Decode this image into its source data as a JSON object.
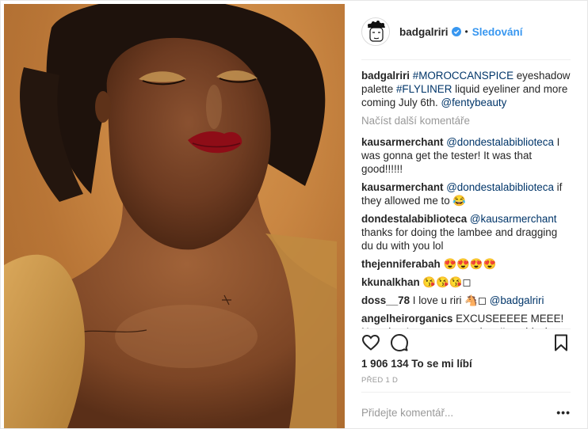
{
  "post": {
    "username": "badgalriri",
    "follow_label": "Sledování",
    "separator": "•",
    "caption_user": "badgalriri",
    "caption_parts": [
      {
        "type": "tag",
        "text": "#MOROCCANSPICE"
      },
      {
        "type": "text",
        "text": " eyeshadow palette "
      },
      {
        "type": "tag",
        "text": "#FLYLINER"
      },
      {
        "type": "text",
        "text": " liquid eyeliner and more coming July 6th. "
      },
      {
        "type": "tag",
        "text": "@fentybeauty"
      }
    ],
    "load_more_label": "Načíst další komentáře",
    "comments": [
      {
        "user": "kausarmerchant",
        "mention": "@dondestalabiblioteca",
        "text": " I was gonna get the tester! It was that good!!!!!!"
      },
      {
        "user": "kausarmerchant",
        "mention": "@dondestalabiblioteca",
        "text": " if they allowed me to 😂"
      },
      {
        "user": "dondestalabiblioteca",
        "mention": "@kausarmerchant",
        "text": " thanks for doing the lambee and dragging du du with you lol"
      },
      {
        "user": "thejenniferabah",
        "mention": "",
        "text": " 😍😍😍😍"
      },
      {
        "user": "kkunalkhan",
        "mention": "",
        "text": " 😘😘😘◻"
      },
      {
        "user": "doss__78",
        "mention": "@badgalriri",
        "text": " I love u riri 🐴◻ "
      },
      {
        "user": "angelheirorganics",
        "mention": "",
        "text": " EXCUSEEEEE MEEE! Now that I got your attention, I'm a black"
      }
    ],
    "likes": "1 906 134 To se mi líbí",
    "timestamp": "PŘED 1 D",
    "comment_placeholder": "Přidejte komentář...",
    "more_label": "•••"
  },
  "icons": {
    "avatar": "cartoon-avatar",
    "verified": "verified-badge-icon",
    "like": "heart-icon",
    "comment": "comment-icon",
    "save": "bookmark-icon"
  },
  "colors": {
    "link_blue": "#3897f0",
    "tag_blue": "#003569",
    "muted": "#999999",
    "text": "#262626"
  }
}
